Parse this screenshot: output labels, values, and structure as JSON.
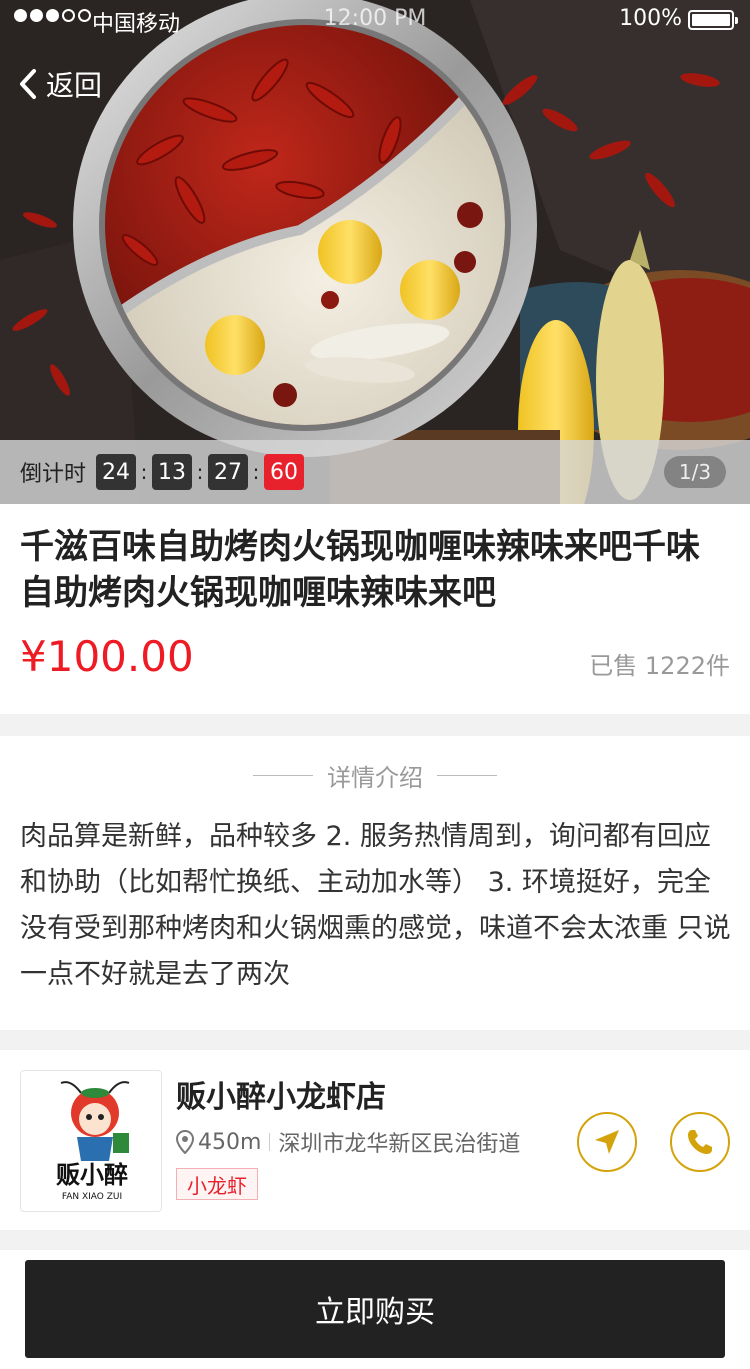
{
  "status_bar": {
    "carrier": "中国移动",
    "time": "12:00 PM",
    "battery": "100%"
  },
  "nav": {
    "back_label": "返回"
  },
  "countdown": {
    "label": "倒计时",
    "hours": "24",
    "minutes": "13",
    "seconds": "27",
    "ms": "60",
    "colon": ":"
  },
  "gallery": {
    "pager": "1/3"
  },
  "product": {
    "title": "千滋百味自助烤肉火锅现咖喱味辣味来吧千味自助烤肉火锅现咖喱味辣味来吧",
    "price": "¥100.00",
    "sold": "已售 1222件"
  },
  "detail": {
    "heading": "详情介绍",
    "body": "肉品算是新鲜，品种较多 2. 服务热情周到，询问都有回应和协助（比如帮忙换纸、主动加水等） 3. 环境挺好，完全没有受到那种烤肉和火锅烟熏的感觉，味道不会太浓重 只说一点不好就是去了两次"
  },
  "store": {
    "name": "贩小醉小龙虾店",
    "distance": "450m",
    "address": "深圳市龙华新区民治街道",
    "tag": "小龙虾",
    "logo_text": "贩小醉",
    "logo_sub": "FAN XIAO ZUI"
  },
  "actions": {
    "buy_label": "立即购买"
  },
  "colors": {
    "accent": "#ee1a24",
    "gold": "#d4a30c",
    "dark": "#222222"
  }
}
